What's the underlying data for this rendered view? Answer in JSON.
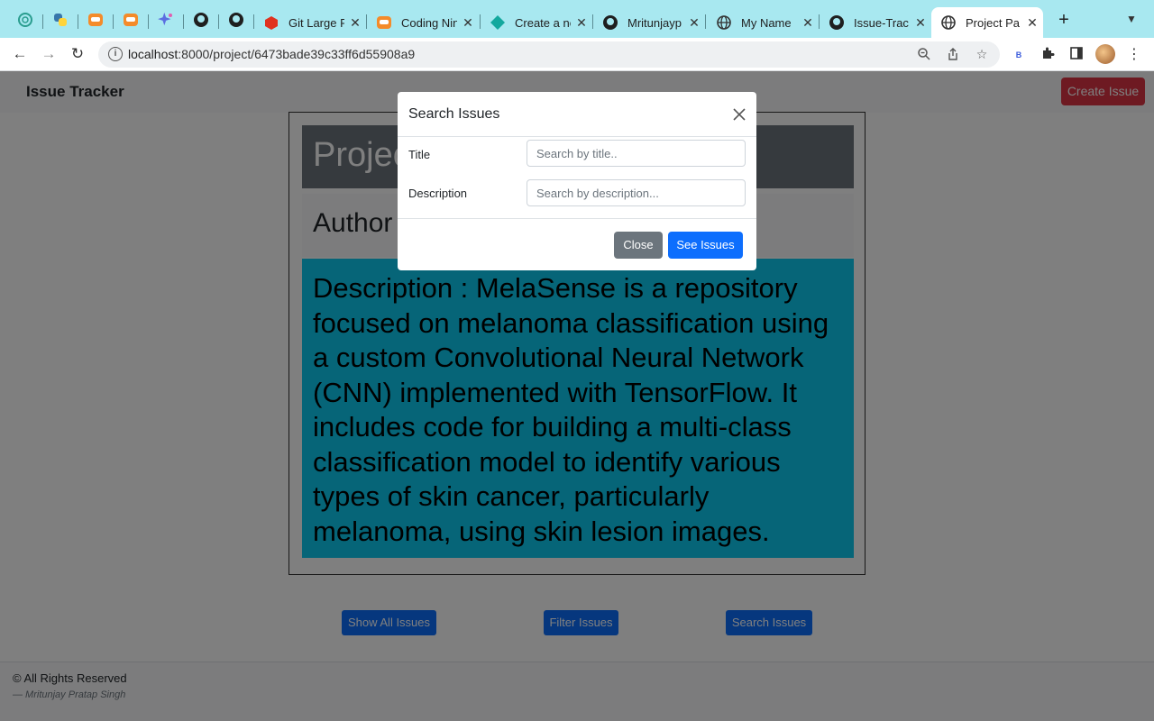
{
  "browser": {
    "tabs": [
      {
        "icon": "chatgpt-icon",
        "title": ""
      },
      {
        "icon": "python-icon",
        "title": ""
      },
      {
        "icon": "coding-ninjas-icon",
        "title": ""
      },
      {
        "icon": "coding-ninjas-icon",
        "title": ""
      },
      {
        "icon": "sparkle-icon",
        "title": ""
      },
      {
        "icon": "github-icon",
        "title": ""
      },
      {
        "icon": "github-icon",
        "title": ""
      },
      {
        "icon": "git-lfs-icon",
        "title": "Git Large F"
      },
      {
        "icon": "coding-ninjas-icon",
        "title": "Coding Nin"
      },
      {
        "icon": "diamond-icon",
        "title": "Create a ne"
      },
      {
        "icon": "github-icon",
        "title": "Mritunjayp"
      },
      {
        "icon": "globe-icon",
        "title": "My Name"
      },
      {
        "icon": "github-icon",
        "title": "Issue-Trac"
      },
      {
        "icon": "globe-icon",
        "title": "Project Pa"
      }
    ],
    "url_host": "localhost",
    "url_path": ":8000/project/6473bade39c33ff6d55908a9",
    "extension_label": "B"
  },
  "navbar": {
    "brand": "Issue Tracker",
    "create_issue": "Create Issue",
    "create_color": "#dc3545"
  },
  "project": {
    "title": "Project",
    "author": "Author",
    "description": "Description : MelaSense is a repository focused on melanoma classification using a custom Convolutional Neural Network (CNN) implemented with TensorFlow. It includes code for building a multi-class classification model to identify various types of skin cancer, particularly melanoma, using skin lesion images."
  },
  "actions": {
    "show_all": "Show All Issues",
    "filter": "Filter Issues",
    "search": "Search Issues"
  },
  "footer": {
    "rights": "© All Rights Reserved",
    "author": "— Mritunjay Pratap Singh"
  },
  "modal": {
    "title": "Search Issues",
    "title_label": "Title",
    "title_placeholder": "Search by title..",
    "description_label": "Description",
    "description_placeholder": "Search by description...",
    "close": "Close",
    "see_issues": "See Issues"
  }
}
